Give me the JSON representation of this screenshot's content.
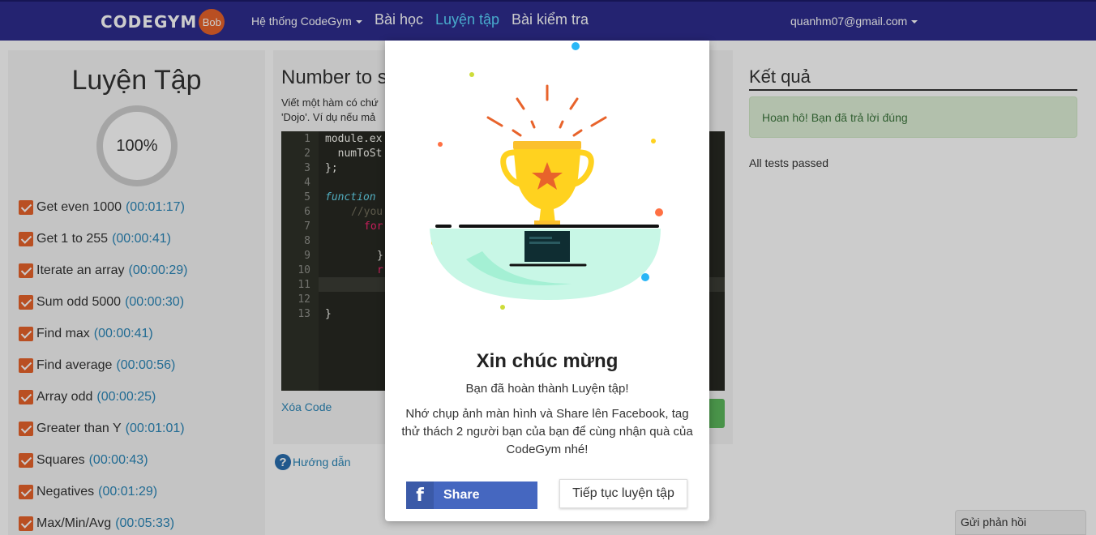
{
  "navbar": {
    "logo_text": "CODEGYM",
    "logo_badge": "Bob",
    "menu_system": "Hệ thống CodeGym",
    "menu_lessons": "Bài học",
    "menu_practice": "Luyện tập",
    "menu_tests": "Bài kiểm tra",
    "user_email": "quanhm07@gmail.com"
  },
  "left_panel": {
    "title": "Luyện Tập",
    "progress": "100%",
    "tasks": [
      {
        "name": "Get even 1000",
        "time": "(00:01:17)"
      },
      {
        "name": "Get 1 to 255",
        "time": "(00:00:41)"
      },
      {
        "name": "Iterate an array",
        "time": "(00:00:29)"
      },
      {
        "name": "Sum odd 5000",
        "time": "(00:00:30)"
      },
      {
        "name": "Find max",
        "time": "(00:00:41)"
      },
      {
        "name": "Find average",
        "time": "(00:00:56)"
      },
      {
        "name": "Array odd",
        "time": "(00:00:25)"
      },
      {
        "name": "Greater than Y",
        "time": "(00:01:01)"
      },
      {
        "name": "Squares",
        "time": "(00:00:43)"
      },
      {
        "name": "Negatives",
        "time": "(00:01:29)"
      },
      {
        "name": "Max/Min/Avg",
        "time": "(00:05:33)"
      }
    ]
  },
  "exercise": {
    "title": "Number to s",
    "desc_line1": "Viết một hàm có chứ",
    "desc_line2": "'Dojo'. Ví dụ nếu mả",
    "clear_code": "Xóa Code",
    "help": "Hướng dẫn"
  },
  "editor": {
    "line_numbers": [
      "1",
      "2",
      "3",
      "4",
      "5",
      "6",
      "7",
      "8",
      "9",
      "10",
      "11",
      "12",
      "13"
    ],
    "line1": "module.ex",
    "line2": "  numToSt",
    "line3": "};",
    "line5_kw": "function",
    "line6": "//you",
    "line7": "for",
    "line9": "}",
    "line10": "r",
    "line13": "}"
  },
  "result": {
    "title": "Kết quả",
    "success": "Hoan hô! Bạn đã trả lời đúng",
    "note": "All tests passed"
  },
  "feedback": "Gửi phản hồi",
  "modal": {
    "title": "Xin chúc mừng",
    "subtitle": "Bạn đã hoàn thành Luyện tập!",
    "message": "Nhớ chụp ảnh màn hình và Share lên Facebook, tag thử thách 2 người bạn của bạn để cùng nhận quà của CodeGym nhé!",
    "share_label": "Share",
    "fb_glyph": "f",
    "continue_label": "Tiếp tục luyện tập"
  },
  "colors": {
    "navbar": "#2d2c8e",
    "accent_orange": "#e8632b",
    "link_blue": "#2a86b8",
    "facebook": "#4567c0",
    "trophy_gold": "#ffd21f",
    "success_bg": "#dff0d8"
  }
}
